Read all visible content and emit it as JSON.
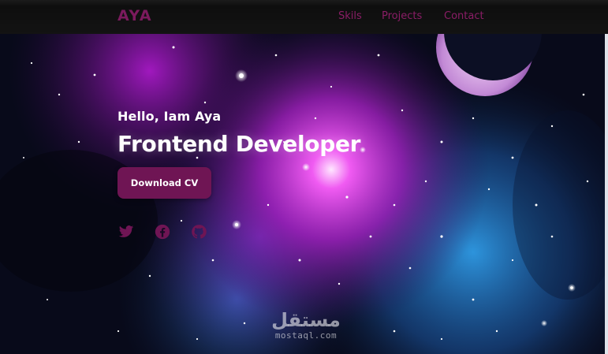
{
  "brand": {
    "logo": "AYA"
  },
  "nav": {
    "items": [
      {
        "label": "Skils"
      },
      {
        "label": "Projects"
      },
      {
        "label": "Contact"
      }
    ]
  },
  "hero": {
    "greeting": "Hello, Iam Aya",
    "title": "Frontend Developer",
    "cv_button": "Download CV",
    "socials": [
      {
        "icon": "twitter-icon"
      },
      {
        "icon": "facebook-icon"
      },
      {
        "icon": "github-icon"
      }
    ]
  },
  "watermark": {
    "arabic": "مستقل",
    "latin": "mostaql.com"
  },
  "colors": {
    "accent": "#6f1554",
    "nav_text": "#8a1d66",
    "navbar_bg": "#111111",
    "text": "#ffffff"
  }
}
